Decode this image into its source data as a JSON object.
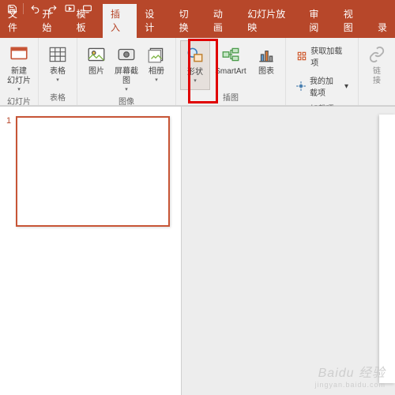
{
  "qat": [
    "save-icon",
    "undo-icon",
    "redo-icon",
    "start-slideshow-icon",
    "touch-mode-icon",
    "customize-icon"
  ],
  "tabs": [
    "文件",
    "开始",
    "模板",
    "插入",
    "设计",
    "切换",
    "动画",
    "幻灯片放映",
    "审阅",
    "视图",
    "录"
  ],
  "active_tab_index": 3,
  "groups": {
    "slides": {
      "label": "幻灯片",
      "new_slide": "新建\n幻灯片"
    },
    "tables": {
      "label": "表格",
      "tables_btn": "表格"
    },
    "images": {
      "label": "图像",
      "picture": "图片",
      "screenshot": "屏幕截图",
      "album": "相册"
    },
    "illus": {
      "label": "插图",
      "shapes": "形状",
      "smartart": "SmartArt",
      "chart": "图表"
    },
    "addins": {
      "label": "加载项",
      "get": "获取加载项",
      "my": "我的加载项"
    },
    "links": {
      "label": "",
      "link": "链\n接"
    }
  },
  "thumb_number": "1",
  "watermark": {
    "brand": "Baidu 经验",
    "url": "jingyan.baidu.com"
  }
}
